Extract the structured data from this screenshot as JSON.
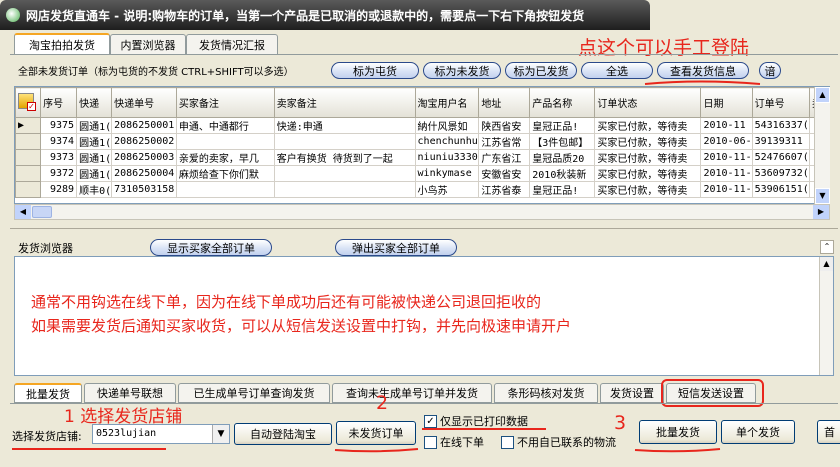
{
  "window": {
    "title": "网店发货直通车 - 说明:购物车的订单，当第一个产品是已取消的或退款中的，需要点一下右下角按钮发货"
  },
  "top_tabs": [
    {
      "label": "淘宝拍拍发货"
    },
    {
      "label": "内置浏览器"
    },
    {
      "label": "发货情况汇报"
    }
  ],
  "annotation_login": "点这个可以手工登陆",
  "orders_bar": {
    "hint": "全部未发货订单（标为屯货的不发货 CTRL+SHIFT可以多选）",
    "buttons": [
      "标为屯货",
      "标为未发货",
      "标为已发货",
      "全选",
      "查看发货信息",
      "谙"
    ]
  },
  "table": {
    "columns": [
      "",
      "序号",
      "快递",
      "快递单号",
      "买家备注",
      "卖家备注",
      "淘宝用户名",
      "地址",
      "产品名称",
      "订单状态",
      "日期",
      "订单号",
      "卖"
    ],
    "rows": [
      [
        "▶",
        "9375",
        "圆通1(",
        "2086250001",
        "申通、中通都行",
        "快递:申通",
        "納什风景如",
        "陕西省安",
        "皇冠正品!",
        "买家已付款，等待卖",
        "2010-11",
        "54316337(",
        ""
      ],
      [
        "",
        "9374",
        "圆通1(",
        "2086250002",
        "",
        "",
        "chenchunhu",
        "江苏省常",
        "【3件包邮】",
        "买家已付款，等待卖",
        "2010-06-",
        "39139311",
        ""
      ],
      [
        "",
        "9373",
        "圆通1(",
        "2086250003",
        "亲爱的卖家，早几",
        "客户有换货 待货到了一起",
        "niuniu3330",
        "广东省江",
        "皇冠品质20",
        "买家已付款，等待卖",
        "2010-11-",
        "52476607(",
        ""
      ],
      [
        "",
        "9372",
        "圆通1(",
        "2086250004",
        "麻烦给查下你们默",
        "",
        "winkymase",
        "安徽省安",
        "2010秋装新",
        "买家已付款，等待卖",
        "2010-11-",
        "53609732(",
        ""
      ],
      [
        "",
        "9289",
        "顺丰0(",
        "7310503158",
        "",
        "",
        "小鸟苏",
        "江苏省泰",
        "皇冠正品!",
        "买家已付款，等待卖",
        "2010-11-",
        "53906151(",
        ""
      ]
    ]
  },
  "browser_panel": {
    "label": "发货浏览器",
    "buttons": [
      "显示买家全部订单",
      "弹出买家全部订单"
    ],
    "message_line1": "通常不用钩选在线下单，因为在线下单成功后还有可能被快递公司退回拒收的",
    "message_line2": "如果需要发货后通知买家收货，可以从短信发送设置中打钩，并先向极速申请开户"
  },
  "bottom_tabs": [
    "批量发货",
    "快递单号联想",
    "已生成单号订单查询发货",
    "查询未生成单号订单并发货",
    "条形码核对发货",
    "发货设置",
    "短信发送设置"
  ],
  "annotations": {
    "step1": "1  选择发货店铺",
    "step2": "2",
    "step3": "3"
  },
  "bottom_controls": {
    "store_label": "选择发货店铺:",
    "store_value": "0523lujian",
    "auto_login_button": "自动登陆淘宝",
    "unshipped_button": "未发货订单",
    "show_printed_label": "仅显示已打印数据",
    "show_printed_checked": true,
    "online_order_label": "在线下单",
    "online_order_checked": false,
    "no_own_logistics_label": "不用自已联系的物流",
    "no_own_logistics_checked": false,
    "batch_ship_button": "批量发货",
    "single_ship_button": "单个发货",
    "home_button": "首"
  },
  "colors": {
    "annotation_red": "#e8261c",
    "title_bar": "#2a2a2a",
    "tab_accent": "#f5a623"
  }
}
